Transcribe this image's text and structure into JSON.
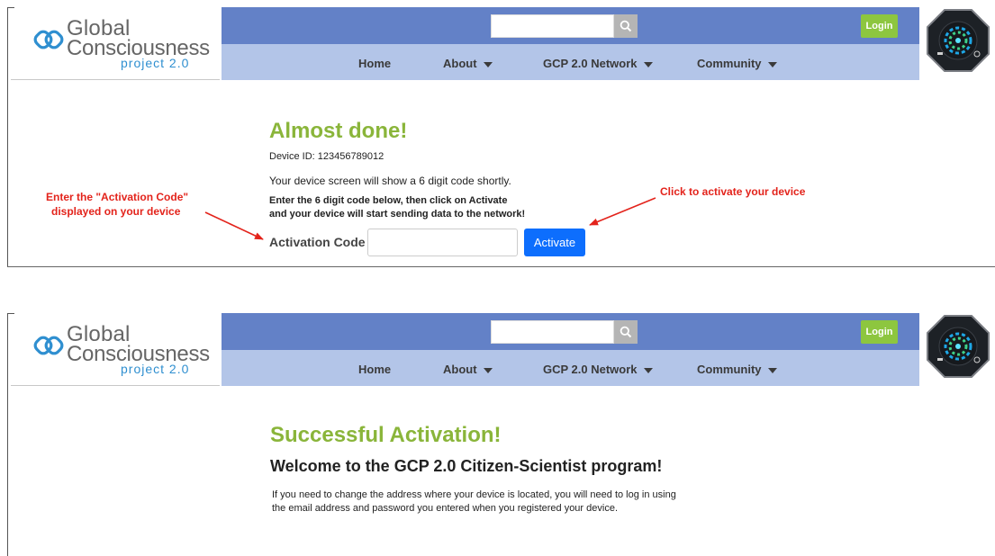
{
  "colors": {
    "nav_top": "#6381c7",
    "nav_bottom": "#b3c5e8",
    "login_green": "#8dc63f",
    "title_green": "#8ab53a",
    "activate_blue": "#0d6efd",
    "annotation_red": "#e3231b",
    "logo_blue": "#2f8fd0"
  },
  "header": {
    "logo_line1": "Global",
    "logo_line2": "Consciousness",
    "logo_line3": "project 2.0",
    "search_placeholder": "",
    "search_icon": "search-icon",
    "login_label": "Login",
    "nav": [
      {
        "label": "Home",
        "has_caret": false
      },
      {
        "label": "About",
        "has_caret": true
      },
      {
        "label": "GCP 2.0 Network",
        "has_caret": true
      },
      {
        "label": "Community",
        "has_caret": true
      }
    ]
  },
  "activation_page": {
    "title": "Almost done!",
    "device_id": "Device ID: 123456789012",
    "screen_note": "Your device screen will show a 6 digit code shortly.",
    "instruction_line1": "Enter the 6 digit code below, then click on Activate",
    "instruction_line2": "and your device will start sending data to the network!",
    "code_label": "Activation Code",
    "code_value": "",
    "activate_label": "Activate",
    "annotation_left_line1": "Enter the \"Activation Code\"",
    "annotation_left_line2": "displayed on your device",
    "annotation_right": "Click to activate your device"
  },
  "success_page": {
    "title": "Successful Activation!",
    "welcome": "Welcome to the GCP 2.0 Citizen-Scientist program!",
    "info_line1": "If you need to change the address where your device is located, you will need to log in using",
    "info_line2": "the email address and password you entered when you registered your device."
  }
}
